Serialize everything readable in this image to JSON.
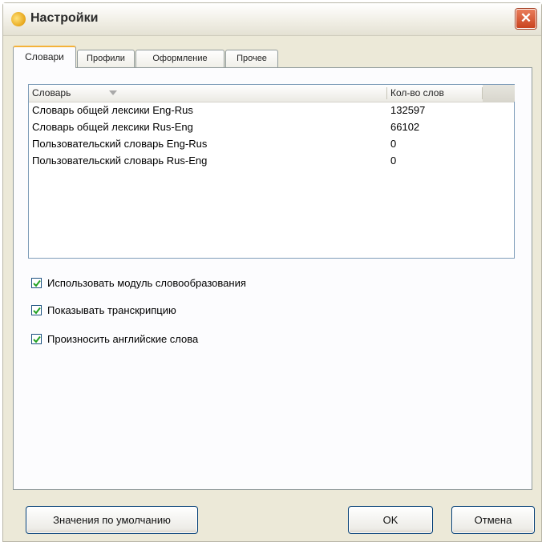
{
  "window": {
    "title": "Настройки",
    "close_glyph": "✕"
  },
  "tabs": [
    {
      "label": "Словари"
    },
    {
      "label": "Профили"
    },
    {
      "label": "Оформление"
    },
    {
      "label": "Прочее"
    }
  ],
  "dictionary_list": {
    "columns": [
      "Словарь",
      "Кол-во слов"
    ],
    "rows": [
      {
        "name": "Словарь общей лексики Eng-Rus",
        "count": "132597"
      },
      {
        "name": "Словарь общей лексики Rus-Eng",
        "count": "66102"
      },
      {
        "name": "Пользовательский словарь Eng-Rus",
        "count": "0"
      },
      {
        "name": "Пользовательский словарь Rus-Eng",
        "count": "0"
      }
    ]
  },
  "options": [
    {
      "label": "Использовать модуль словообразования",
      "checked": true
    },
    {
      "label": "Показывать транскрипцию",
      "checked": true
    },
    {
      "label": "Произносить английские слова",
      "checked": true
    }
  ],
  "buttons": {
    "defaults": "Значения по умолчанию",
    "ok": "OK",
    "cancel": "Отмена"
  },
  "colors": {
    "accent_tab": "#f4b23a",
    "checkbox_check": "#21a121"
  }
}
